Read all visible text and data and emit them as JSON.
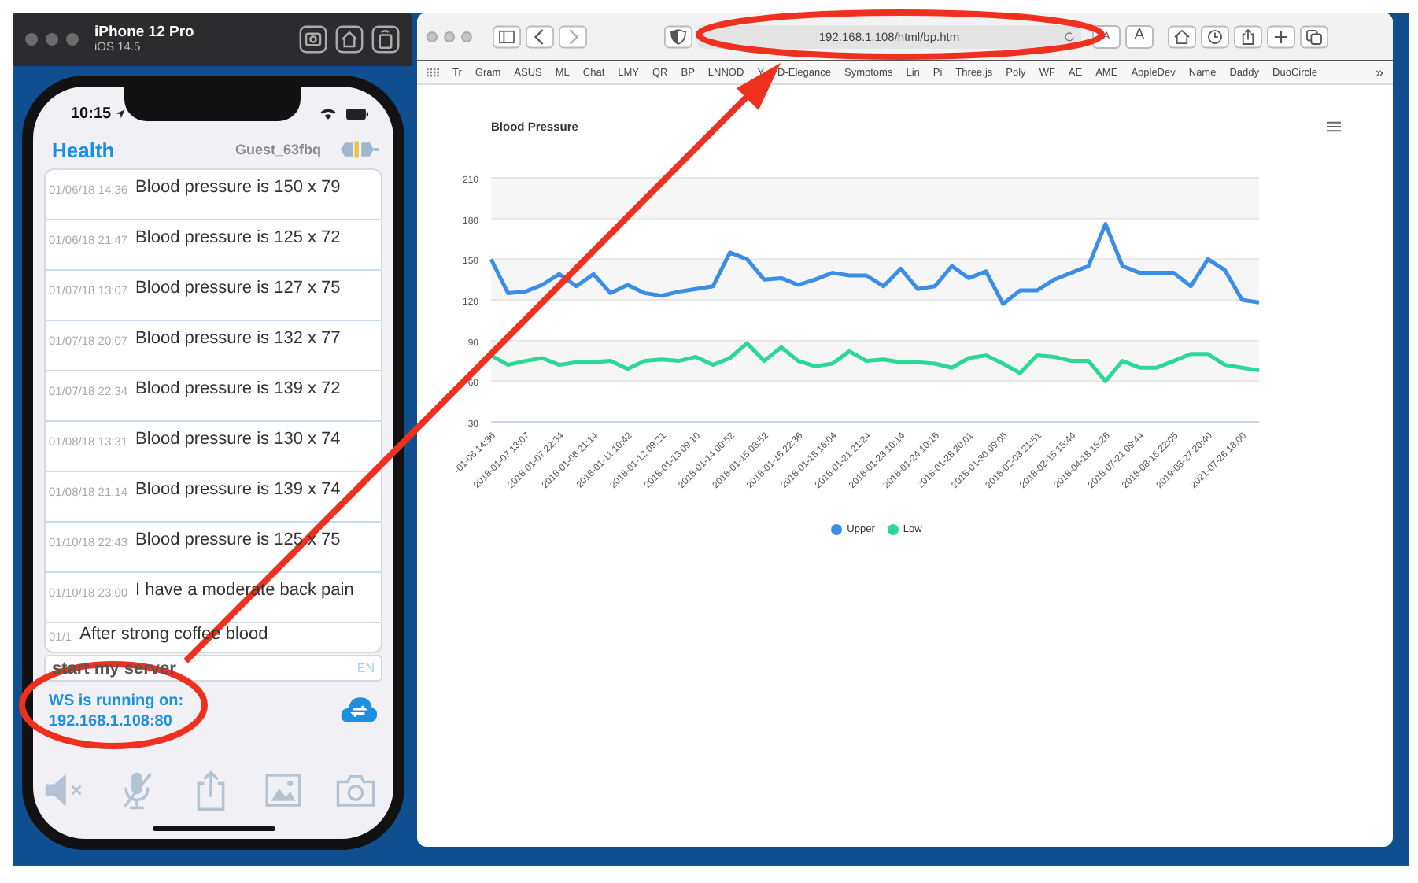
{
  "simulator": {
    "device": "iPhone 12 Pro",
    "os": "iOS 14.5"
  },
  "phone": {
    "time": "10:15",
    "title": "Health",
    "user": "Guest_63fbq",
    "messages": [
      {
        "time": "01/06/18 14:36",
        "text": "Blood pressure is 150 x 79"
      },
      {
        "time": "01/06/18 21:47",
        "text": "Blood pressure is 125 x 72"
      },
      {
        "time": "01/07/18 13:07",
        "text": "Blood pressure is 127 x 75"
      },
      {
        "time": "01/07/18 20:07",
        "text": "Blood pressure is 132 x 77"
      },
      {
        "time": "01/07/18 22:34",
        "text": "Blood pressure is 139 x 72"
      },
      {
        "time": "01/08/18 13:31",
        "text": "Blood pressure is 130 x 74"
      },
      {
        "time": "01/08/18 21:14",
        "text": "Blood pressure is 139 x 74"
      },
      {
        "time": "01/10/18 22:43",
        "text": "Blood pressure is 125 x 75"
      },
      {
        "time": "01/10/18 23:00",
        "text": "I have a moderate back pain"
      },
      {
        "time": "01/1",
        "text": "After strong coffee blood"
      }
    ],
    "input": {
      "value": "start my server",
      "language": "EN"
    },
    "status_lines": [
      "WS is running on:",
      "192.168.1.108:80"
    ]
  },
  "browser": {
    "url": "192.168.1.108/html/bp.htm",
    "text_size_buttons": [
      "A",
      "A"
    ],
    "bookmarks": [
      "Tr",
      "Gram",
      "ASUS",
      "ML",
      "Chat",
      "LMY",
      "QR",
      "BP",
      "LNNOD",
      "Y",
      "D-Elegance",
      "Symptoms",
      "Lin",
      "Pi",
      "Three.js",
      "Poly",
      "WF",
      "AE",
      "AME",
      "AppleDev",
      "Name",
      "Daddy",
      "DuoCircle"
    ],
    "more": "»"
  },
  "chart_data": {
    "type": "line",
    "title": "Blood Pressure",
    "categories": [
      "-01-06 14:36",
      null,
      "2018-01-07 13:07",
      null,
      "2018-01-07 22:34",
      null,
      "2018-01-08 21:14",
      null,
      "2018-01-11 10:42",
      null,
      "2018-01-12 09:21",
      null,
      "2018-01-13 09:10",
      null,
      "2018-01-14 00:52",
      null,
      "2018-01-15 08:52",
      null,
      "2018-01-16 22:36",
      null,
      "2018-01-18 16:04",
      null,
      "2018-01-21 21:24",
      null,
      "2018-01-23 10:14",
      null,
      "2018-01-24 10:16",
      null,
      "2018-01-28 20:01",
      null,
      "2018-01-30 09:05",
      null,
      "2018-02-03 21:51",
      null,
      "2018-02-15 15:44",
      null,
      "2018-04-18 15:28",
      null,
      "2018-07-21 09:44",
      null,
      "2018-08-15 22:05",
      null,
      "2019-08-27 20:40",
      null,
      "2021-07-26 18:00",
      null
    ],
    "grid": true,
    "legend": true,
    "ylim": [
      30,
      210
    ],
    "yticks": [
      30,
      60,
      90,
      120,
      150,
      180,
      210
    ],
    "series": [
      {
        "name": "Upper",
        "color": "#3b8ee8",
        "values": [
          150,
          125,
          126,
          131,
          139,
          130,
          139,
          125,
          131,
          125,
          123,
          126,
          128,
          130,
          155,
          150,
          135,
          136,
          131,
          135,
          140,
          138,
          138,
          130,
          143,
          128,
          130,
          145,
          136,
          141,
          117,
          127,
          127,
          135,
          140,
          145,
          176,
          145,
          140,
          140,
          140,
          130,
          150,
          142,
          120,
          118
        ]
      },
      {
        "name": "Low",
        "color": "#2dd897",
        "values": [
          79,
          72,
          75,
          77,
          72,
          74,
          74,
          75,
          69,
          75,
          76,
          75,
          78,
          72,
          77,
          88,
          75,
          85,
          75,
          71,
          73,
          82,
          75,
          76,
          74,
          74,
          73,
          70,
          77,
          79,
          73,
          66,
          79,
          78,
          75,
          75,
          60,
          75,
          70,
          70,
          75,
          80,
          80,
          72,
          70,
          68
        ]
      }
    ]
  }
}
